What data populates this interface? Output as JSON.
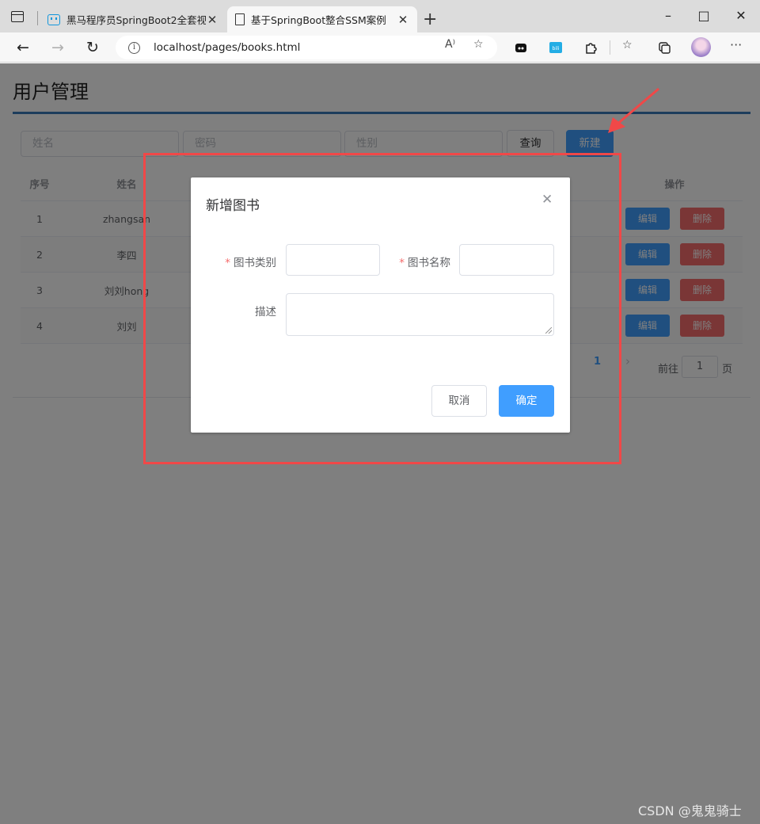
{
  "browser": {
    "tabs": [
      {
        "title": "黑马程序员SpringBoot2全套视频",
        "icon": "bilibili-icon"
      },
      {
        "title": "基于SpringBoot整合SSM案例",
        "icon": "document-icon"
      }
    ],
    "url": "localhost/pages/books.html",
    "window_controls": [
      "–",
      "□",
      "✕"
    ]
  },
  "page": {
    "title": "用户管理",
    "filters": {
      "name_placeholder": "姓名",
      "password_placeholder": "密码",
      "gender_placeholder": "性别",
      "query_label": "查询",
      "new_label": "新建"
    },
    "table": {
      "headers": {
        "index": "序号",
        "name": "姓名",
        "ops": "操作"
      },
      "rows": [
        {
          "index": "1",
          "name": "zhangsan"
        },
        {
          "index": "2",
          "name": "李四"
        },
        {
          "index": "3",
          "name": "刘刘hong"
        },
        {
          "index": "4",
          "name": "刘刘"
        }
      ],
      "edit_label": "编辑",
      "delete_label": "删除"
    },
    "pagination": {
      "current": "1",
      "goto_prefix": "前往",
      "goto_value": "1",
      "goto_suffix": "页"
    }
  },
  "dialog": {
    "title": "新增图书",
    "fields": {
      "type_label": "图书类别",
      "name_label": "图书名称",
      "desc_label": "描述",
      "required_mark": "*"
    },
    "cancel_label": "取消",
    "ok_label": "确定"
  },
  "watermark": "CSDN @鬼鬼骑士",
  "colors": {
    "primary": "#409eff",
    "danger": "#f56c6c",
    "annotation": "#f04848"
  }
}
